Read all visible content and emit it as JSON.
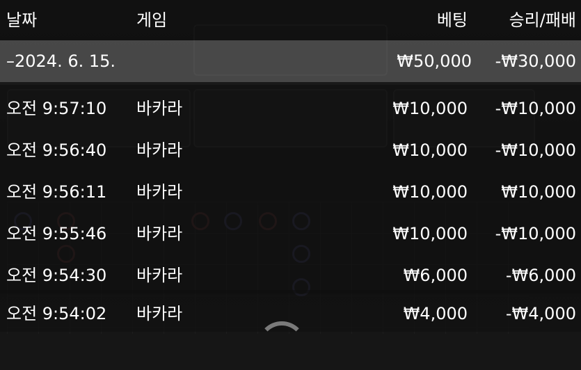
{
  "header": {
    "date": "날짜",
    "game": "게임",
    "bet": "베팅",
    "result": "승리/패배"
  },
  "group": {
    "date": "–2024. 6. 15.",
    "bet": "₩50,000",
    "result": "-₩30,000"
  },
  "rows": [
    {
      "time": "오전 9:57:10",
      "game": "바카라",
      "bet": "₩10,000",
      "result": "-₩10,000"
    },
    {
      "time": "오전 9:56:40",
      "game": "바카라",
      "bet": "₩10,000",
      "result": "-₩10,000"
    },
    {
      "time": "오전 9:56:11",
      "game": "바카라",
      "bet": "₩10,000",
      "result": "₩10,000"
    },
    {
      "time": "오전 9:55:46",
      "game": "바카라",
      "bet": "₩10,000",
      "result": "-₩10,000"
    },
    {
      "time": "오전 9:54:30",
      "game": "바카라",
      "bet": "₩6,000",
      "result": "-₩6,000"
    },
    {
      "time": "오전 9:54:02",
      "game": "바카라",
      "bet": "₩4,000",
      "result": "-₩4,000"
    }
  ]
}
